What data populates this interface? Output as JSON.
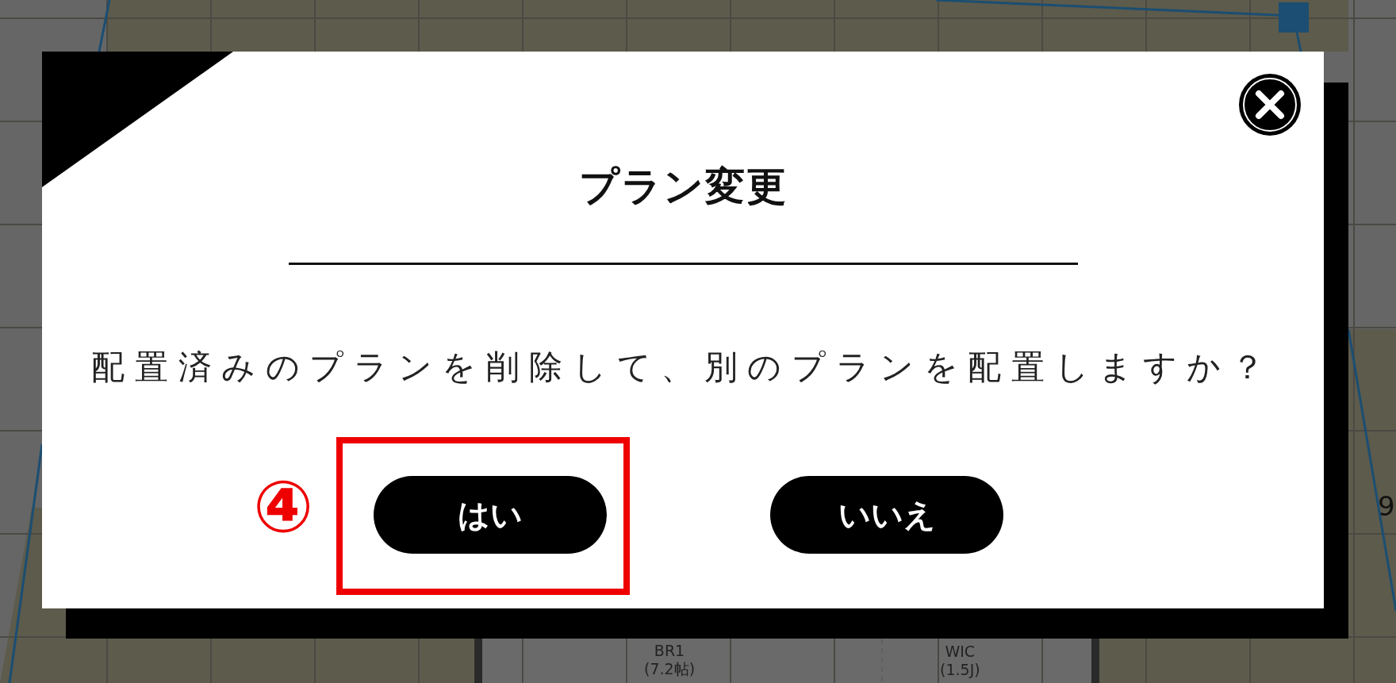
{
  "canvas": {
    "rooms": [
      {
        "name": "BR1",
        "area": "(7.2帖)"
      },
      {
        "name": "WIC",
        "area": "(1.5J)"
      }
    ],
    "dimension": "9"
  },
  "dialog": {
    "title": "プラン変更",
    "message": "配置済みのプランを削除して、別のプランを配置しますか？",
    "buttons": [
      {
        "label": "はい",
        "highlighted": true,
        "step": "④"
      },
      {
        "label": "いいえ",
        "highlighted": false
      }
    ]
  }
}
